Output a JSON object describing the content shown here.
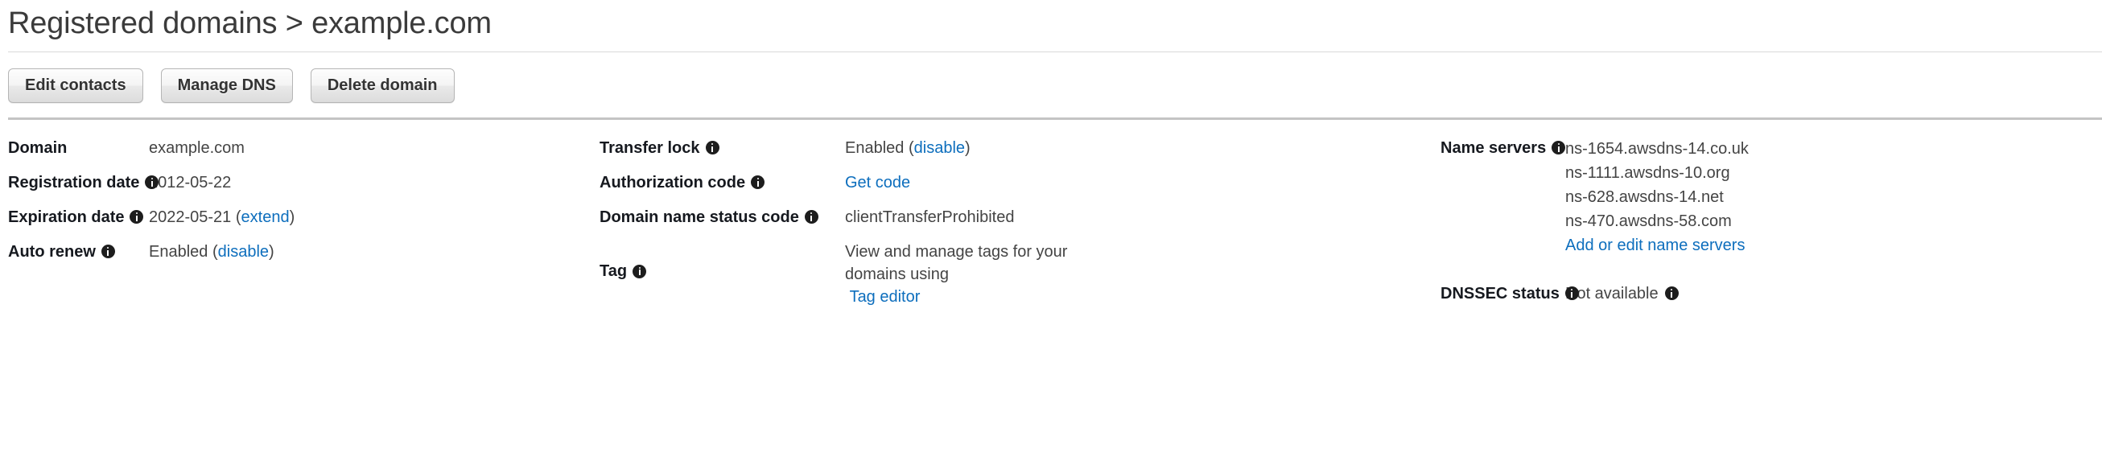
{
  "header": {
    "breadcrumb_parent": "Registered domains",
    "breadcrumb_separator": ">",
    "breadcrumb_current": "example.com",
    "title_full": "Registered domains > example.com"
  },
  "toolbar": {
    "edit_contacts_label": "Edit contacts",
    "manage_dns_label": "Manage DNS",
    "delete_domain_label": "Delete domain"
  },
  "details": {
    "column_1": {
      "domain": {
        "label": "Domain",
        "value": "example.com"
      },
      "registration_date": {
        "label": "Registration date",
        "value": "2012-05-22"
      },
      "expiration_date": {
        "label": "Expiration date",
        "value": "2022-05-21",
        "open_paren": "(",
        "link": "extend",
        "close_paren": ")"
      },
      "auto_renew": {
        "label": "Auto renew",
        "value": "Enabled",
        "open_paren": "(",
        "link": "disable",
        "close_paren": ")"
      }
    },
    "column_2": {
      "transfer_lock": {
        "label": "Transfer lock",
        "value": "Enabled",
        "open_paren": "(",
        "link": "disable",
        "close_paren": ")"
      },
      "authorization_code": {
        "label": "Authorization code",
        "link": "Get code"
      },
      "domain_name_status_code": {
        "label": "Domain name status code",
        "value": "clientTransferProhibited"
      },
      "tag": {
        "label": "Tag",
        "text": "View and manage tags for your domains using",
        "link": "Tag editor"
      }
    },
    "column_3": {
      "name_servers": {
        "label": "Name servers",
        "values": [
          "ns-1654.awsdns-14.co.uk",
          "ns-1111.awsdns-10.org",
          "ns-628.awsdns-14.net",
          "ns-470.awsdns-58.com"
        ],
        "link": "Add or edit name servers"
      },
      "dnssec_status": {
        "label": "DNSSEC status",
        "value": "Not available"
      }
    }
  },
  "icons": {
    "info": "info-icon"
  },
  "colors": {
    "link": "#0d6ebd",
    "label_text": "#16191f",
    "value_text": "#444444",
    "title_text": "#3b3b3b",
    "rule_thin": "#d9d9d9",
    "rule_thick": "#c4c4c4",
    "info_icon_fill": "#1d1d1d",
    "button_border": "#b5b5b5"
  }
}
